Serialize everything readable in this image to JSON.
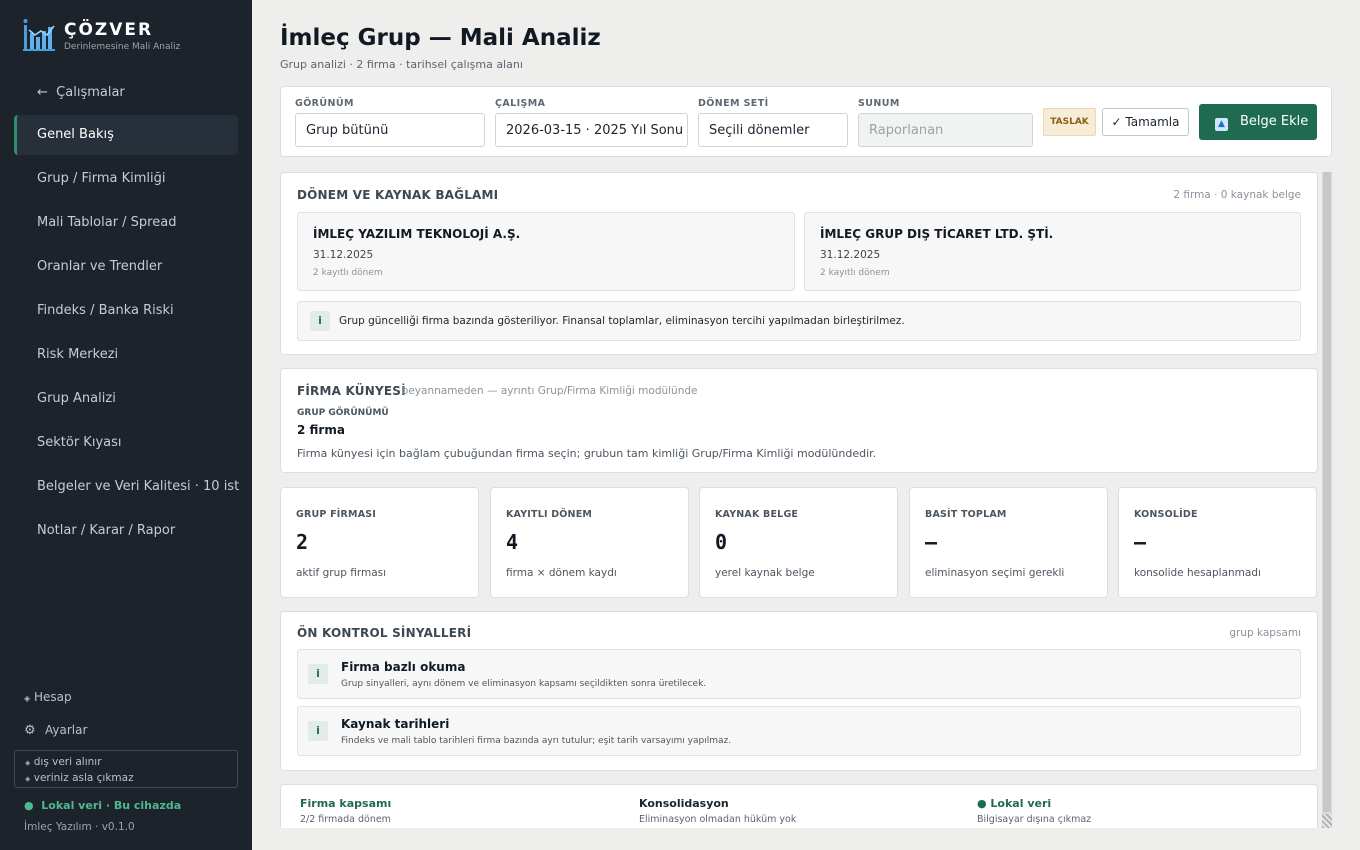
{
  "sidebar": {
    "brand": "ÇÖZVER",
    "tagline": "Derinlemesine Mali Analiz",
    "back_label": "Çalışmalar",
    "nav": [
      {
        "label": "Genel Bakış",
        "active": true
      },
      {
        "label": "Grup / Firma Kimliği"
      },
      {
        "label": "Mali Tablolar / Spread"
      },
      {
        "label": "Oranlar ve Trendler"
      },
      {
        "label": "Findeks / Banka Riski"
      },
      {
        "label": "Risk Merkezi"
      },
      {
        "label": "Grup Analizi"
      },
      {
        "label": "Sektör Kıyası"
      },
      {
        "label": "Belgeler ve Veri Kalitesi  ·  10 ist"
      },
      {
        "label": "Notlar / Karar / Rapor"
      }
    ],
    "account_label": "Hesap",
    "settings_label": "Ayarlar",
    "privacy_lines": [
      "dış veri alınır",
      "veriniz asla çıkmaz"
    ],
    "local_status": "Lokal veri · Bu cihazda",
    "version": "İmleç Yazılım · v0.1.0"
  },
  "header": {
    "title": "İmleç Grup — Mali Analiz",
    "subtitle": "Grup analizi · 2 firma · tarihsel çalışma alanı"
  },
  "context_bar": {
    "view": {
      "label": "GÖRÜNÜM",
      "value": "Grup bütünü"
    },
    "study": {
      "label": "ÇALIŞMA",
      "value": "2026-03-15 · 2025 Yıl Sonu"
    },
    "period_set": {
      "label": "DÖNEM SETİ",
      "value": "Seçili dönemler"
    },
    "presentation": {
      "label": "SUNUM",
      "value": "Raporlanan"
    },
    "draft_badge": "TASLAK",
    "complete_label": "Tamamla",
    "add_doc_label": "Belge Ekle"
  },
  "period_context": {
    "title": "DÖNEM VE KAYNAK BAĞLAMI",
    "meta": "2 firma · 0 kaynak belge",
    "firms": [
      {
        "name": "İMLEÇ YAZILIM TEKNOLOJİ A.Ş.",
        "date": "31.12.2025",
        "periods": "2 kayıtlı dönem"
      },
      {
        "name": "İMLEÇ GRUP DIŞ TİCARET LTD. ŞTİ.",
        "date": "31.12.2025",
        "periods": "2 kayıtlı dönem"
      }
    ],
    "note": "Grup güncelliği firma bazında gösteriliyor. Finansal toplamlar, eliminasyon tercihi yapılmadan birleştirilmez."
  },
  "firm_profile": {
    "title": "FİRMA KÜNYESİ",
    "meta": "· beyannameden — ayrıntı Grup/Firma Kimliği modülünde",
    "group_view_label": "GRUP GÖRÜNÜMÜ",
    "group_view_value": "2 firma",
    "help": "Firma künyesi için bağlam çubuğundan firma seçin; grubun tam kimliği Grup/Firma Kimliği modülündedir."
  },
  "stats": [
    {
      "label": "GRUP FİRMASI",
      "value": "2",
      "desc": "aktif grup firması"
    },
    {
      "label": "KAYITLI DÖNEM",
      "value": "4",
      "desc": "firma × dönem kaydı"
    },
    {
      "label": "KAYNAK BELGE",
      "value": "0",
      "desc": "yerel kaynak belge"
    },
    {
      "label": "BASİT TOPLAM",
      "value": "—",
      "desc": "eliminasyon seçimi gerekli"
    },
    {
      "label": "KONSOLİDE",
      "value": "—",
      "desc": "konsolide hesaplanmadı"
    }
  ],
  "signals": {
    "title": "ÖN KONTROL SİNYALLERİ",
    "meta": "grup kapsamı",
    "items": [
      {
        "title": "Firma bazlı okuma",
        "desc": "Grup sinyalleri, aynı dönem ve eliminasyon kapsamı seçildikten sonra üretilecek."
      },
      {
        "title": "Kaynak tarihleri",
        "desc": "Findeks ve mali tablo tarihleri firma bazında ayrı tutulur; eşit tarih varsayımı yapılmaz."
      }
    ]
  },
  "footer": [
    {
      "title": "Firma kapsamı",
      "sub": "2/2 firmada dönem"
    },
    {
      "title": "Konsolidasyon",
      "sub": "Eliminasyon olmadan hüküm yok"
    },
    {
      "title": "● Lokal veri",
      "sub": "Bilgisayar dışına çıkmaz"
    }
  ],
  "colors": {
    "sidebar_bg": "#1d232b",
    "accent_green": "#1f6b50",
    "local_green": "#4fb98e",
    "draft_badge_bg": "#f6ecd7",
    "page_bg": "#eeeeec"
  }
}
